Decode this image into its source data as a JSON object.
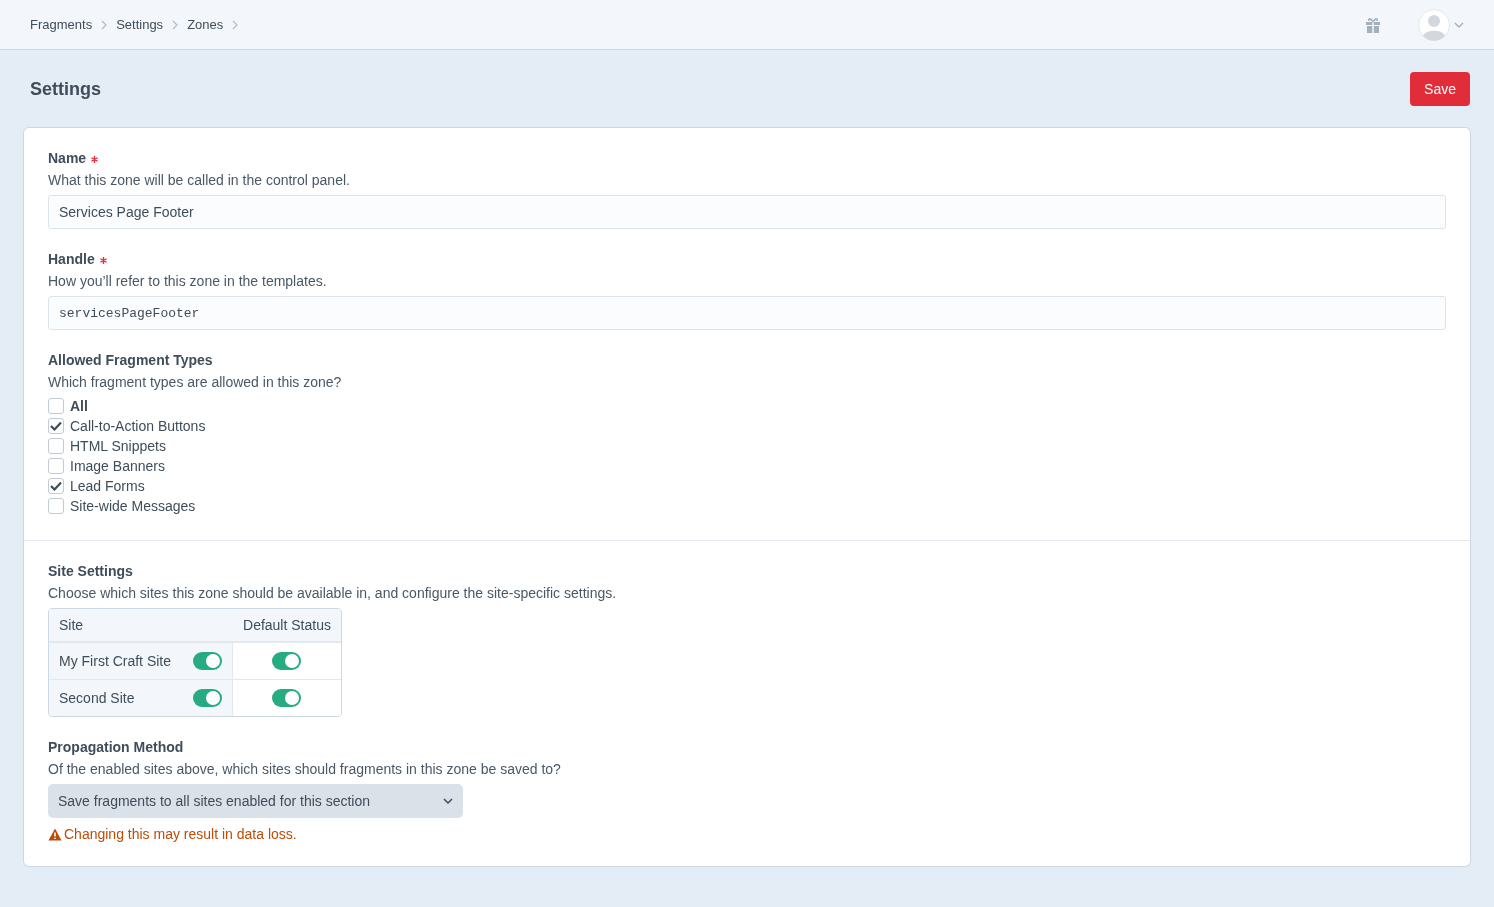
{
  "breadcrumbs": [
    "Fragments",
    "Settings",
    "Zones"
  ],
  "page_title": "Settings",
  "save_button": "Save",
  "fields": [
    {
      "label": "Name",
      "required": true,
      "instructions": "What this zone will be called in the control panel.",
      "value": "Services Page Footer",
      "kind": "text"
    },
    {
      "label": "Handle",
      "required": true,
      "instructions": "How you’ll refer to this zone in the templates.",
      "value": "servicesPageFooter",
      "kind": "code"
    }
  ],
  "fragment_types": {
    "label": "Allowed Fragment Types",
    "instructions": "Which fragment types are allowed in this zone?",
    "options": [
      {
        "label": "All",
        "kind": "all",
        "checked": false
      },
      {
        "label": "Call-to-Action Buttons",
        "kind": "option",
        "checked": true
      },
      {
        "label": "HTML Snippets",
        "kind": "option",
        "checked": false
      },
      {
        "label": "Image Banners",
        "kind": "option",
        "checked": false
      },
      {
        "label": "Lead Forms",
        "kind": "option",
        "checked": true
      },
      {
        "label": "Site-wide Messages",
        "kind": "option",
        "checked": false
      }
    ]
  },
  "site_settings": {
    "label": "Site Settings",
    "instructions": "Choose which sites this zone should be available in, and configure the site-specific settings.",
    "columns": [
      "Site",
      "Default Status"
    ],
    "rows": [
      {
        "site": "My First Craft Site",
        "enabled": true,
        "default_status": true
      },
      {
        "site": "Second Site",
        "enabled": true,
        "default_status": true
      }
    ]
  },
  "propagation": {
    "label": "Propagation Method",
    "instructions": "Of the enabled sites above, which sites should fragments in this zone be saved to?",
    "value": "Save fragments to all sites enabled for this section",
    "warning": "Changing this may result in data loss."
  }
}
